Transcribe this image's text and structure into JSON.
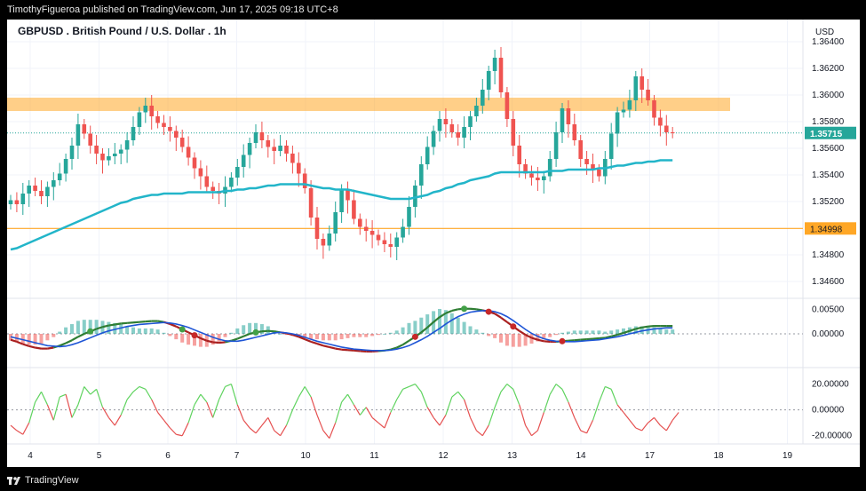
{
  "header": {
    "publisher_line": "TimothyFigueroa published on TradingView.com, Jun 17, 2025 09:18 UTC+8"
  },
  "footer": {
    "brand": "TradingView"
  },
  "colors": {
    "up_candle": "#26a69a",
    "down_candle": "#ef5350",
    "sma": "#22b5c9",
    "resistance_zone": "#ffa726",
    "support_line": "#ffa726",
    "macd_fast": "#2e7d32",
    "macd_slow": "#1e55d6",
    "cross_up": "#43a047",
    "cross_down": "#c62828"
  },
  "chart_data": [
    {
      "type": "candlestick",
      "title": "GBPUSD . British Pound / U.S. Dollar . 1h",
      "currency": "USD",
      "ylim": [
        1.345,
        1.365
      ],
      "y_ticks": [
        "1.36400",
        "1.36200",
        "1.36000",
        "1.35800",
        "1.35600",
        "1.35400",
        "1.35200",
        "1.35000",
        "1.34800",
        "1.34600"
      ],
      "x_ticks": [
        "4",
        "5",
        "6",
        "7",
        "10",
        "11",
        "12",
        "13",
        "14",
        "17",
        "18",
        "19"
      ],
      "last_price": "1.35715",
      "support_level_label": "1.34998",
      "support_level": 1.34998,
      "resistance_zone": [
        1.3588,
        1.3598
      ],
      "close": [
        1.3521,
        1.3518,
        1.3526,
        1.3532,
        1.3528,
        1.3524,
        1.3531,
        1.3536,
        1.3541,
        1.3552,
        1.3562,
        1.3578,
        1.3571,
        1.3562,
        1.3556,
        1.3551,
        1.3554,
        1.3556,
        1.3559,
        1.3566,
        1.3576,
        1.3587,
        1.3592,
        1.3584,
        1.3579,
        1.3576,
        1.3573,
        1.3568,
        1.3561,
        1.3553,
        1.3545,
        1.3539,
        1.3531,
        1.3528,
        1.3526,
        1.3531,
        1.3538,
        1.3546,
        1.3555,
        1.3564,
        1.3572,
        1.3566,
        1.3561,
        1.3558,
        1.3562,
        1.3556,
        1.3549,
        1.3541,
        1.353,
        1.3508,
        1.3492,
        1.3487,
        1.3496,
        1.3512,
        1.3529,
        1.3521,
        1.3507,
        1.3501,
        1.3498,
        1.3495,
        1.3491,
        1.3488,
        1.3486,
        1.3493,
        1.3501,
        1.3516,
        1.3532,
        1.3548,
        1.3561,
        1.3573,
        1.3582,
        1.3578,
        1.3572,
        1.3568,
        1.3576,
        1.3584,
        1.3592,
        1.3604,
        1.3618,
        1.3628,
        1.3602,
        1.3582,
        1.3562,
        1.3548,
        1.3541,
        1.3538,
        1.3536,
        1.3539,
        1.3552,
        1.3572,
        1.359,
        1.3578,
        1.3566,
        1.3552,
        1.3548,
        1.3544,
        1.3539,
        1.3552,
        1.3571,
        1.3587,
        1.3589,
        1.3596,
        1.3614,
        1.3604,
        1.3596,
        1.3583,
        1.3577,
        1.3572,
        1.35715
      ],
      "sma_values": [
        1.3484,
        1.3485,
        1.3487,
        1.3489,
        1.3491,
        1.3493,
        1.3495,
        1.3497,
        1.3499,
        1.3501,
        1.3503,
        1.3505,
        1.3507,
        1.3509,
        1.3511,
        1.3513,
        1.3515,
        1.3517,
        1.3519,
        1.352,
        1.3522,
        1.3523,
        1.3524,
        1.3525,
        1.3525,
        1.3526,
        1.3526,
        1.3526,
        1.3526,
        1.3527,
        1.3527,
        1.3527,
        1.3527,
        1.3527,
        1.3527,
        1.3528,
        1.3528,
        1.3529,
        1.3529,
        1.353,
        1.353,
        1.3531,
        1.3532,
        1.3532,
        1.3533,
        1.3533,
        1.3533,
        1.3533,
        1.3533,
        1.3532,
        1.3531,
        1.353,
        1.353,
        1.3529,
        1.3529,
        1.3529,
        1.3528,
        1.3527,
        1.3526,
        1.3525,
        1.3524,
        1.3523,
        1.3522,
        1.3522,
        1.3522,
        1.3522,
        1.3523,
        1.3524,
        1.3525,
        1.3527,
        1.3528,
        1.353,
        1.3531,
        1.3533,
        1.3534,
        1.3536,
        1.3537,
        1.3538,
        1.3539,
        1.3541,
        1.3542,
        1.3542,
        1.3542,
        1.3542,
        1.3542,
        1.3542,
        1.3542,
        1.3542,
        1.3543,
        1.3543,
        1.3543,
        1.3544,
        1.3544,
        1.3544,
        1.3544,
        1.3544,
        1.3545,
        1.3545,
        1.3546,
        1.3547,
        1.3547,
        1.3548,
        1.3549,
        1.3549,
        1.355,
        1.355,
        1.3551,
        1.3551,
        1.3551
      ]
    },
    {
      "type": "line",
      "name": "macd",
      "ylim": [
        -0.0065,
        0.0065
      ],
      "y_ticks": [
        "0.00500",
        "0.00000"
      ],
      "fast": [
        -0.0012,
        -0.0016,
        -0.0021,
        -0.0025,
        -0.0028,
        -0.003,
        -0.003,
        -0.0028,
        -0.0024,
        -0.0019,
        -0.0013,
        -0.0006,
        0.0,
        0.0005,
        0.001,
        0.0014,
        0.0017,
        0.0019,
        0.0021,
        0.0022,
        0.0023,
        0.0024,
        0.0025,
        0.0026,
        0.0026,
        0.0024,
        0.002,
        0.0015,
        0.0009,
        0.0003,
        -0.0003,
        -0.0009,
        -0.0014,
        -0.0017,
        -0.0018,
        -0.0017,
        -0.0014,
        -0.001,
        -0.0005,
        0.0,
        0.0003,
        0.0005,
        0.0006,
        0.0005,
        0.0003,
        0.0001,
        -0.0002,
        -0.0006,
        -0.0011,
        -0.0016,
        -0.002,
        -0.0024,
        -0.0027,
        -0.003,
        -0.0032,
        -0.0033,
        -0.0034,
        -0.0035,
        -0.0036,
        -0.0036,
        -0.0035,
        -0.0034,
        -0.0032,
        -0.0028,
        -0.0022,
        -0.0014,
        -0.0006,
        0.0003,
        0.0013,
        0.0024,
        0.0034,
        0.0042,
        0.0047,
        0.005,
        0.0051,
        0.0051,
        0.005,
        0.0048,
        0.0045,
        0.0041,
        0.0033,
        0.0024,
        0.0015,
        0.0006,
        -0.0002,
        -0.0008,
        -0.0012,
        -0.0015,
        -0.0016,
        -0.0016,
        -0.0015,
        -0.0014,
        -0.0013,
        -0.0012,
        -0.0011,
        -0.001,
        -0.0009,
        -0.0008,
        -0.0005,
        -0.0002,
        0.0002,
        0.0006,
        0.001,
        0.0013,
        0.0015,
        0.0016,
        0.0016,
        0.0016,
        0.0016
      ],
      "slow": [
        -0.0006,
        -0.0009,
        -0.0012,
        -0.0015,
        -0.0018,
        -0.0021,
        -0.0024,
        -0.0025,
        -0.0026,
        -0.0025,
        -0.0022,
        -0.0018,
        -0.0013,
        -0.0008,
        -0.0003,
        0.0002,
        0.0006,
        0.0009,
        0.0012,
        0.0015,
        0.0017,
        0.0019,
        0.002,
        0.0021,
        0.0022,
        0.0023,
        0.0022,
        0.002,
        0.0017,
        0.0013,
        0.0008,
        0.0003,
        -0.0002,
        -0.0007,
        -0.0011,
        -0.0014,
        -0.0015,
        -0.0015,
        -0.0013,
        -0.001,
        -0.0007,
        -0.0004,
        -0.0001,
        0.0002,
        0.0003,
        0.0002,
        0.0,
        -0.0003,
        -0.0007,
        -0.0011,
        -0.0015,
        -0.0018,
        -0.0021,
        -0.0024,
        -0.0027,
        -0.0029,
        -0.0031,
        -0.0032,
        -0.0033,
        -0.0034,
        -0.0034,
        -0.0034,
        -0.0033,
        -0.0031,
        -0.0028,
        -0.0024,
        -0.0018,
        -0.0012,
        -0.0005,
        0.0003,
        0.0011,
        0.002,
        0.0028,
        0.0035,
        0.004,
        0.0044,
        0.0046,
        0.0047,
        0.0047,
        0.0045,
        0.0041,
        0.0035,
        0.0027,
        0.0018,
        0.0009,
        0.0001,
        -0.0005,
        -0.001,
        -0.0013,
        -0.0015,
        -0.0016,
        -0.0016,
        -0.0016,
        -0.0015,
        -0.0014,
        -0.0013,
        -0.0012,
        -0.001,
        -0.0008,
        -0.0006,
        -0.0003,
        0.0,
        0.0003,
        0.0006,
        0.0008,
        0.001,
        0.0011,
        0.0012,
        0.0012
      ],
      "cross_up_at": [
        13,
        28,
        40,
        74
      ],
      "cross_down_at": [
        30,
        66,
        78,
        82,
        90
      ]
    },
    {
      "type": "line",
      "name": "oscillator",
      "ylim": [
        -25,
        30
      ],
      "y_ticks": [
        "20.00000",
        "0.00000",
        "-20.00000"
      ],
      "values": [
        -12,
        -16,
        -19,
        -10,
        6,
        14,
        4,
        -8,
        10,
        12,
        -6,
        4,
        18,
        12,
        16,
        2,
        -6,
        -12,
        -4,
        8,
        14,
        18,
        16,
        8,
        -2,
        -8,
        -14,
        -19,
        -20,
        -10,
        4,
        12,
        6,
        -6,
        8,
        18,
        20,
        4,
        -8,
        -14,
        -18,
        -12,
        -6,
        -16,
        -20,
        -12,
        0,
        10,
        18,
        10,
        -4,
        -16,
        -22,
        -10,
        6,
        12,
        4,
        -4,
        2,
        -6,
        -10,
        -14,
        -2,
        8,
        16,
        18,
        20,
        14,
        2,
        -6,
        -12,
        -4,
        10,
        14,
        8,
        -6,
        -16,
        -20,
        -12,
        2,
        14,
        20,
        16,
        4,
        -12,
        -20,
        -16,
        -2,
        12,
        20,
        16,
        6,
        -6,
        -16,
        -18,
        -8,
        6,
        18,
        16,
        4,
        -2,
        -8,
        -14,
        -16,
        -10,
        -6,
        -12,
        -16,
        -8,
        -2
      ]
    }
  ]
}
